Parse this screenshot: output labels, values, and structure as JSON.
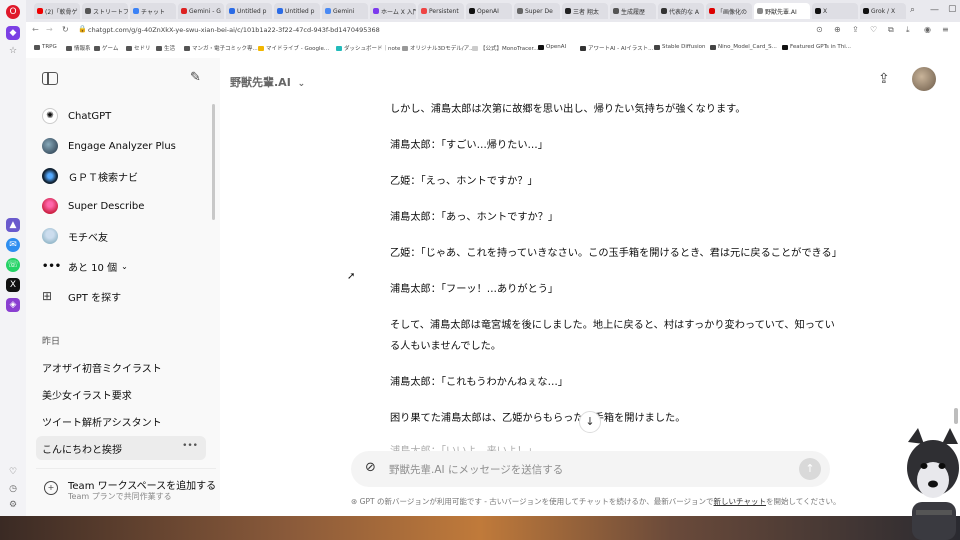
{
  "browser": {
    "tabs": [
      {
        "label": "(2)「軟骨ゲ"
      },
      {
        "label": "ストリートフ"
      },
      {
        "label": "チャット"
      },
      {
        "label": "Gemini - G"
      },
      {
        "label": "Untitled p"
      },
      {
        "label": "Untitled p"
      },
      {
        "label": "Gemini"
      },
      {
        "label": "ホーム X 入門"
      },
      {
        "label": "Persistent"
      },
      {
        "label": "OpenAI"
      },
      {
        "label": "Super De"
      },
      {
        "label": "三者 翔太"
      },
      {
        "label": "生成履歴"
      },
      {
        "label": "代表的な A"
      },
      {
        "label": "「画像化の"
      },
      {
        "label": "野獣先輩.AI"
      },
      {
        "label": "X"
      },
      {
        "label": "Grok / X"
      }
    ],
    "url": "chatgpt.com/g/g-40ZnXkX-ye-swu-xian-bei-ai/c/101b1a22-3f22-47cd-943f-bd1470495368",
    "bookmarks": [
      {
        "label": "TRPG"
      },
      {
        "label": "情報系"
      },
      {
        "label": "ゲーム"
      },
      {
        "label": "セドリ"
      },
      {
        "label": "生活"
      },
      {
        "label": "マンガ・電子コミック専..."
      },
      {
        "label": "マイドライブ - Google..."
      },
      {
        "label": "ダッシュボード｜note"
      },
      {
        "label": "オリジナル3Dモデル/ア..."
      },
      {
        "label": "【公式】MonoTracer..."
      },
      {
        "label": "OpenAI"
      },
      {
        "label": "アワートAI - AIイラスト..."
      },
      {
        "label": "Stable Diffusion"
      },
      {
        "label": "Nino_Model_Card_S..."
      },
      {
        "label": "Featured GPTs in Thi..."
      }
    ]
  },
  "sidebar": {
    "gpts": [
      {
        "label": "ChatGPT"
      },
      {
        "label": "Engage Analyzer Plus"
      },
      {
        "label": "ＧＰＴ検索ナビ"
      },
      {
        "label": "Super Describe"
      },
      {
        "label": "モチベ友"
      }
    ],
    "more_label": "あと 10 個",
    "explore_label": "GPT を探す",
    "history_heading": "昨日",
    "history": [
      {
        "label": "アオザイ初音ミクイラスト"
      },
      {
        "label": "美少女イラスト要求"
      },
      {
        "label": "ツイート解析アシスタント"
      },
      {
        "label": "こんにちわと挨拶"
      }
    ],
    "team_title": "Team ワークスペースを追加する",
    "team_sub": "Team プランで共同作業する"
  },
  "main": {
    "model_name": "野獣先輩.AI",
    "messages": [
      "しかし、浦島太郎は次第に故郷を思い出し、帰りたい気持ちが強くなります。",
      "浦島太郎：「すごい…帰りたい…」",
      "乙姫：「えっ、ホントですか？」",
      "浦島太郎：「あっ、ホントですか？」",
      "乙姫：「じゃあ、これを持っていきなさい。この玉手箱を開けるとき、君は元に戻ることができる」",
      "浦島太郎：「フーッ！…ありがとう」",
      "そして、浦島太郎は竜宮城を後にしました。地上に戻ると、村はすっかり変わっていて、知ってい",
      "る人もいませんでした。",
      "浦島太郎：「これもうわかんねぇな…」",
      "困り果てた浦島太郎は、乙姫からもらった玉手箱を開けました。",
      "浦島太郎：「いいよ、来いよ！」"
    ],
    "composer_placeholder": "野獣先輩.AI にメッセージを送信する",
    "footer_prefix": "GPT の新バージョンが利用可能です - 古いバージョンを使用してチャットを続けるか、最新バージョンで",
    "footer_link": "新しいチャット",
    "footer_suffix": "を開始してください。"
  },
  "colors": {
    "accent": "#0d0d0d",
    "sidebar_bg": "#f9f9f9",
    "composer_bg": "#f4f4f4"
  }
}
